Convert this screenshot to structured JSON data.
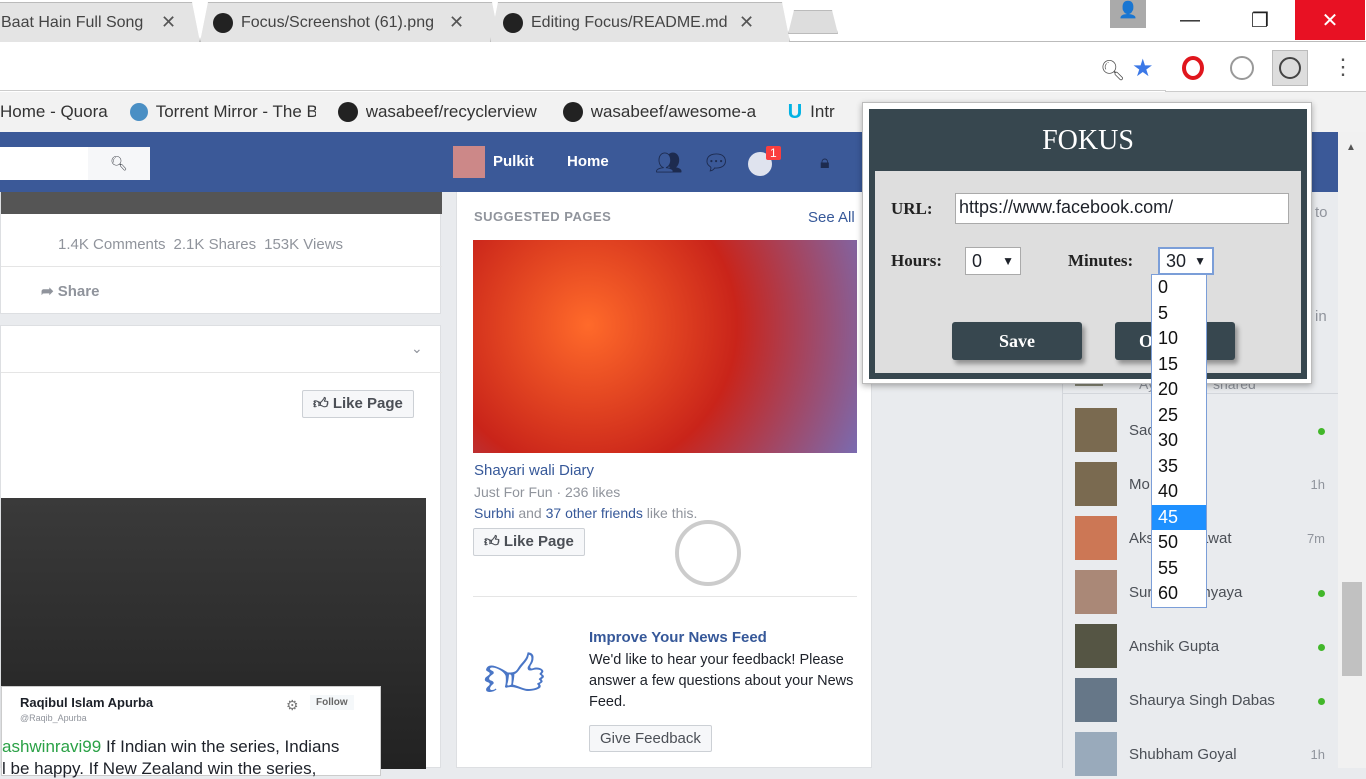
{
  "browser": {
    "tabs": [
      {
        "title": "i Baat Hain Full Song"
      },
      {
        "title": "Focus/Screenshot (61).png"
      },
      {
        "title": "Editing Focus/README.md"
      }
    ],
    "bookmarks": [
      "Home - Quora",
      "Torrent Mirror - The B",
      "wasabeef/recyclerview",
      "wasabeef/awesome-a",
      "Intr"
    ]
  },
  "fb": {
    "user": "Pulkit",
    "home": "Home",
    "notif_count": "1",
    "post": {
      "comments": "1.4K Comments",
      "shares": "2.1K Shares",
      "views": "153K Views",
      "share": "Share"
    },
    "like_page": "Like Page",
    "tweet": {
      "name": "Raqibul Islam Apurba",
      "handle": "@Raqib_Apurba",
      "follow": "Follow",
      "mention": "ashwinravi99",
      "text": " If Indian win the series, Indians",
      "text2": "l be happy. If New Zealand win the series,"
    },
    "suggested": {
      "title": "SUGGESTED PAGES",
      "see_all": "See All",
      "page_name": "Shayari wali Diary",
      "meta": "Just For Fun · 236 likes",
      "friend": "Surbhi",
      "friends_rest": " and ",
      "others": "37 other friends",
      "like_this": " like this.",
      "like_button": "Like Page"
    },
    "feedback": {
      "title": "Improve Your News Feed",
      "body": "We'd like to hear your feedback! Please answer a few questions about your News Feed.",
      "button": "Give Feedback"
    },
    "chat_partial": [
      "to",
      "in",
      "Ay",
      "shared"
    ],
    "friends": [
      {
        "name": "Sac",
        "status": "online"
      },
      {
        "name": "Mo          a",
        "status": "1h"
      },
      {
        "name": "Aks        mawat",
        "status": "7m"
      },
      {
        "name": "Sur        adhyaya",
        "status": "online"
      },
      {
        "name": "Anshik Gupta",
        "status": "online"
      },
      {
        "name": "Shaurya Singh Dabas",
        "status": "online"
      },
      {
        "name": "Shubham Goyal",
        "status": "1h"
      }
    ]
  },
  "fokus": {
    "title": "FOKUS",
    "url_label": "URL:",
    "url_value": "https://www.facebook.com/",
    "hours_label": "Hours:",
    "hours_value": "0",
    "minutes_label": "Minutes:",
    "minutes_value": "30",
    "save": "Save",
    "options": "Op",
    "minute_options": [
      "0",
      "5",
      "10",
      "15",
      "20",
      "25",
      "30",
      "35",
      "40",
      "45",
      "50",
      "55",
      "60"
    ],
    "highlighted": "45"
  },
  "colors": {
    "fb_blue": "#3b5998",
    "fokus_dark": "#37474f",
    "highlight": "#1e90ff"
  }
}
